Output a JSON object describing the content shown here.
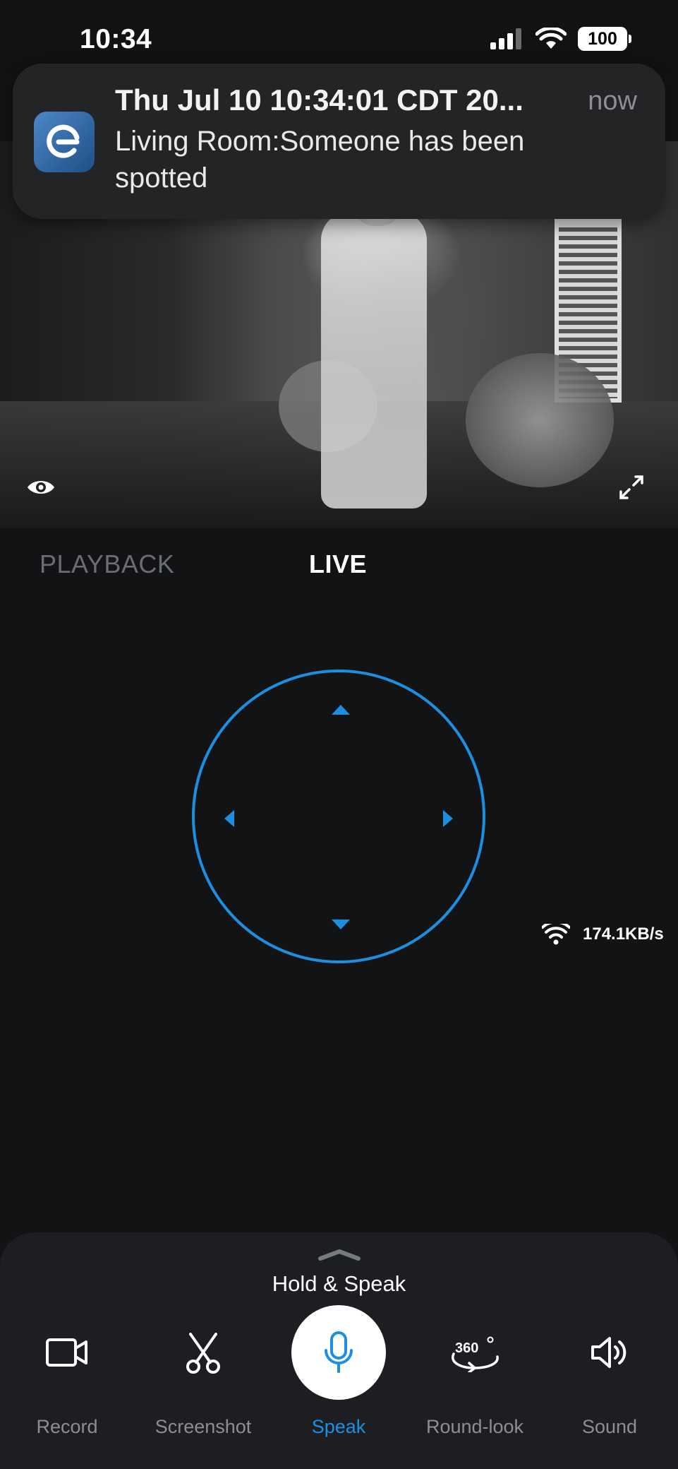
{
  "status_bar": {
    "time": "10:34",
    "battery": "100"
  },
  "notification": {
    "title": "Thu Jul 10 10:34:01 CDT 20...",
    "time": "now",
    "body": "Living Room:Someone has been spotted"
  },
  "tabs": {
    "playback": "PLAYBACK",
    "live": "LIVE",
    "active": "LIVE"
  },
  "network": {
    "speed": "174.1KB/s"
  },
  "bottom_panel": {
    "hint": "Hold & Speak",
    "actions": [
      {
        "label": "Record",
        "icon": "video-camera-icon"
      },
      {
        "label": "Screenshot",
        "icon": "scissors-icon"
      },
      {
        "label": "Speak",
        "icon": "microphone-icon"
      },
      {
        "label": "Round-look",
        "icon": "rotate-360-icon",
        "icon_text": "360"
      },
      {
        "label": "Sound",
        "icon": "speaker-icon"
      }
    ]
  },
  "colors": {
    "accent": "#1d8fe0",
    "background": "#111315",
    "panel": "#1d1e21"
  }
}
